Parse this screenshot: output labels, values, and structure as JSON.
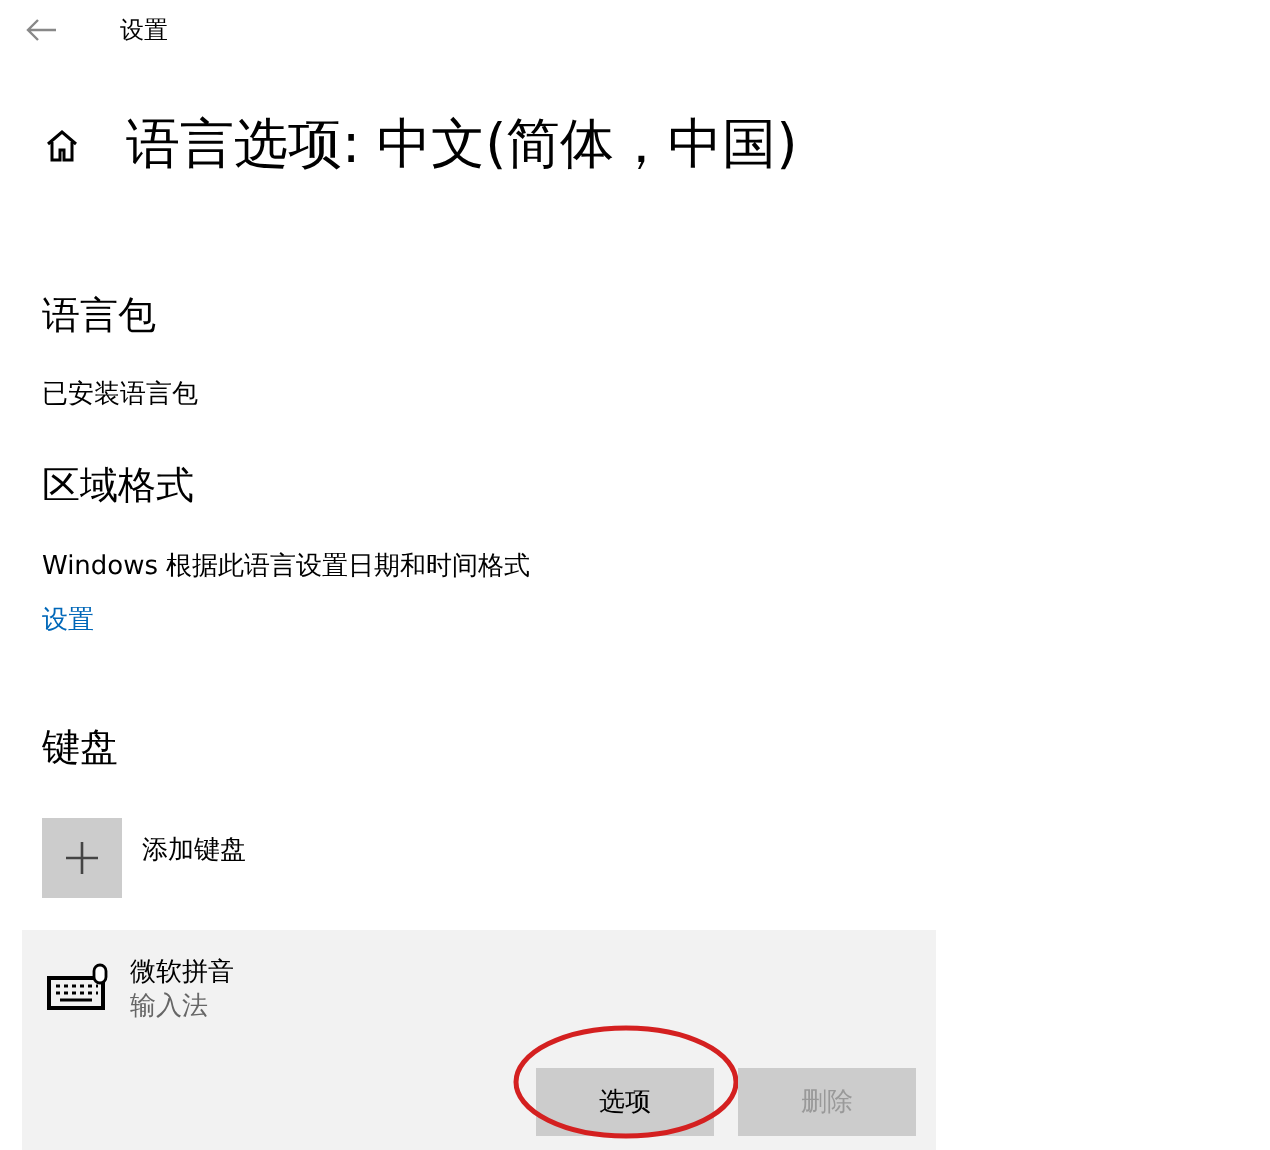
{
  "header": {
    "title": "设置"
  },
  "page_title": "语言选项: 中文(简体，中国)",
  "language_pack": {
    "heading": "语言包",
    "status": "已安装语言包"
  },
  "regional_format": {
    "heading": "区域格式",
    "description": "Windows 根据此语言设置日期和时间格式",
    "link": "设置"
  },
  "keyboard": {
    "heading": "键盘",
    "add_label": "添加键盘",
    "keyboards": [
      {
        "name": "微软拼音",
        "type": "输入法",
        "buttons": [
          {
            "label": "选项",
            "disabled": false,
            "highlighted": true
          },
          {
            "label": "删除",
            "disabled": true,
            "highlighted": false
          }
        ]
      }
    ]
  }
}
